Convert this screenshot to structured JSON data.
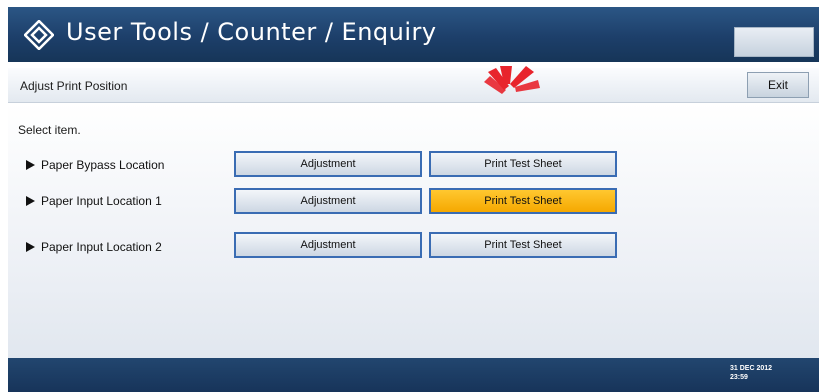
{
  "header": {
    "title": "User Tools / Counter / Enquiry",
    "logo_icon": "diamond-logo-icon"
  },
  "subheader": {
    "title": "Adjust Print Position",
    "exit_label": "Exit"
  },
  "main": {
    "prompt": "Select item.",
    "rows": [
      {
        "label": "Paper Bypass Location",
        "adjust_label": "Adjustment",
        "print_label": "Print Test Sheet",
        "print_selected": false
      },
      {
        "label": "Paper Input Location 1",
        "adjust_label": "Adjustment",
        "print_label": "Print Test Sheet",
        "print_selected": true
      },
      {
        "label": "Paper Input Location 2",
        "adjust_label": "Adjustment",
        "print_label": "Print Test Sheet",
        "print_selected": false
      }
    ]
  },
  "footer": {
    "date": "31 DEC 2012",
    "time": "23:59"
  },
  "colors": {
    "header_bg": "#1d3f6a",
    "selected_button": "#ffbb1c",
    "button_border": "#3a6cb3",
    "pointer": "#e8242c"
  }
}
